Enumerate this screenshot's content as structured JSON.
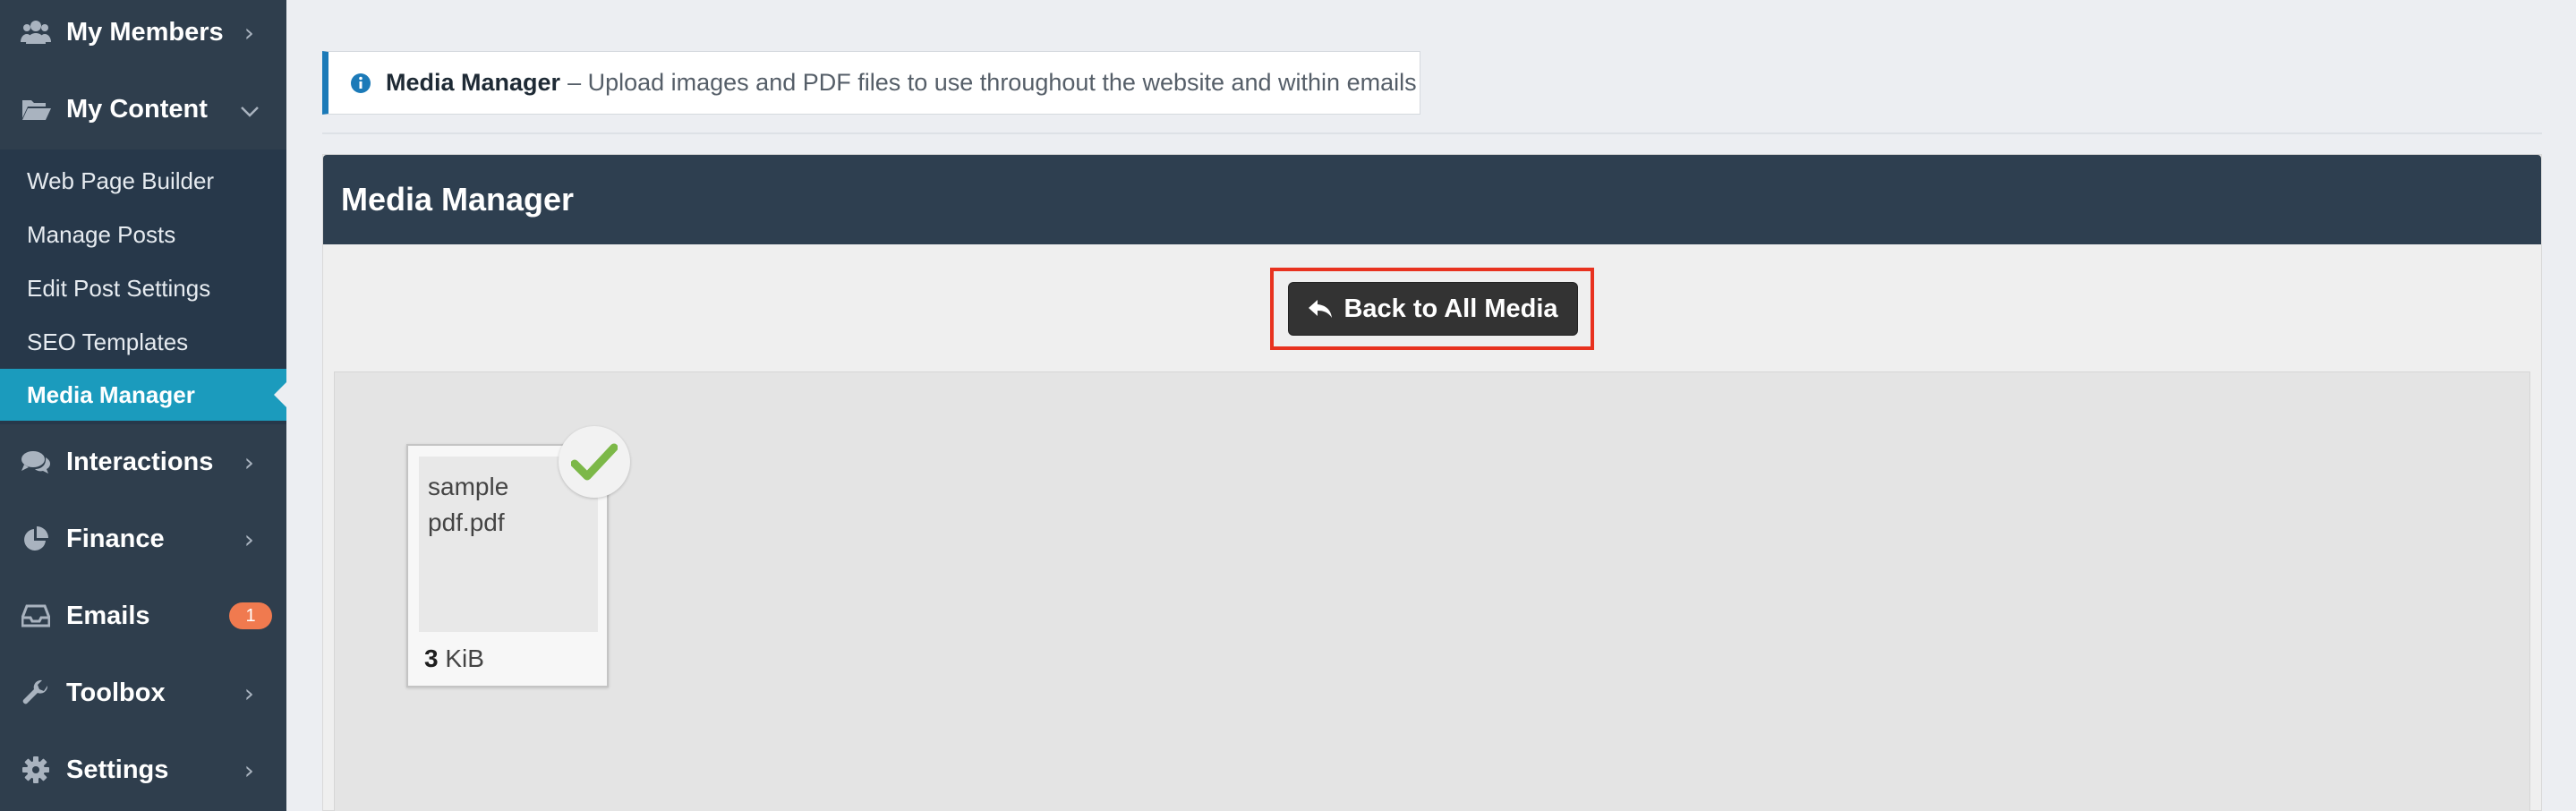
{
  "sidebar": {
    "items": [
      {
        "label": "My Members",
        "icon": "users-icon"
      },
      {
        "label": "My Content",
        "icon": "folder-open-icon",
        "expanded": true
      },
      {
        "label": "Interactions",
        "icon": "comments-icon"
      },
      {
        "label": "Finance",
        "icon": "pie-chart-icon"
      },
      {
        "label": "Emails",
        "icon": "inbox-icon",
        "badge": "1"
      },
      {
        "label": "Toolbox",
        "icon": "wrench-icon"
      },
      {
        "label": "Settings",
        "icon": "gear-icon"
      }
    ],
    "submenu": [
      {
        "label": "Web Page Builder"
      },
      {
        "label": "Manage Posts"
      },
      {
        "label": "Edit Post Settings"
      },
      {
        "label": "SEO Templates"
      },
      {
        "label": "Media Manager",
        "active": true
      }
    ]
  },
  "notice": {
    "title": "Media Manager",
    "text": "– Upload images and PDF files to use throughout the website and within emails"
  },
  "panel": {
    "title": "Media Manager",
    "back_label": "Back to All Media"
  },
  "media": [
    {
      "name": "sample pdf.pdf",
      "size_value": "3",
      "size_unit": "KiB",
      "selected": true
    }
  ],
  "colors": {
    "sidebar_bg": "#2f3e4d",
    "active_item": "#1b9bbd",
    "badge": "#f07a4f",
    "highlight": "#e8321f",
    "check": "#7cb848"
  }
}
